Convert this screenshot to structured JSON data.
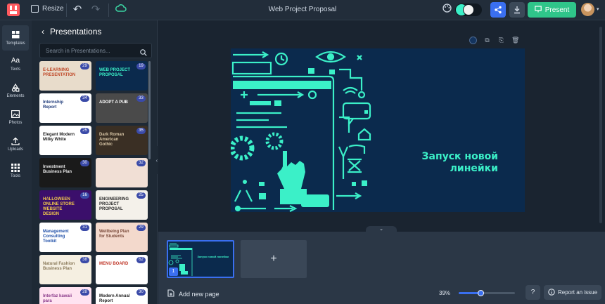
{
  "topbar": {
    "resize_label": "Resize",
    "document_title": "Web Project Proposal",
    "present_label": "Present"
  },
  "rail": {
    "items": [
      {
        "label": "Templates",
        "icon": "templates-icon"
      },
      {
        "label": "Texts",
        "icon": "text-icon"
      },
      {
        "label": "Elements",
        "icon": "elements-icon"
      },
      {
        "label": "Photos",
        "icon": "photo-icon"
      },
      {
        "label": "Uploads",
        "icon": "upload-icon"
      },
      {
        "label": "Tools",
        "icon": "tools-icon"
      }
    ]
  },
  "panel": {
    "title": "Presentations",
    "search_placeholder": "Search in Presentations...",
    "templates": [
      {
        "title": "E-LEARNING PRESENTATION",
        "count": "29",
        "bg": "#e8dccb",
        "fg": "#c04b2b"
      },
      {
        "title": "WEB PROJECT PROPOSAL",
        "count": "19",
        "bg": "#0b2a4d",
        "fg": "#3bf0c8"
      },
      {
        "title": "Internship Report",
        "count": "34",
        "bg": "#ffffff",
        "fg": "#1f3b7a"
      },
      {
        "title": "ADOPT A PUB",
        "count": "33",
        "bg": "#4a4a4a",
        "fg": "#ffffff"
      },
      {
        "title": "Elegant Modern Milky White",
        "count": "25",
        "bg": "#ffffff",
        "fg": "#222222"
      },
      {
        "title": "Dark Roman American Gothic",
        "count": "35",
        "bg": "#3a2f24",
        "fg": "#d9c7a7"
      },
      {
        "title": "Investment Business Plan",
        "count": "30",
        "bg": "#1a1a1a",
        "fg": "#e6e6e6"
      },
      {
        "title": "",
        "count": "32",
        "bg": "#f1dfd5",
        "fg": "#8a6a5a"
      },
      {
        "title": "HALLOWEEN ONLINE STORE WEBSITE DESIGN",
        "count": "16",
        "bg": "#3b0f6b",
        "fg": "#f2c94c"
      },
      {
        "title": "ENGINEERING PROJECT PROPOSAL",
        "count": "25",
        "bg": "#f4f1ea",
        "fg": "#2a2a2a"
      },
      {
        "title": "Management Consulting Toolkit",
        "count": "31",
        "bg": "#ffffff",
        "fg": "#1f4fa8"
      },
      {
        "title": "Wellbeing Plan for Students",
        "count": "29",
        "bg": "#f3d9cc",
        "fg": "#7a4a3a"
      },
      {
        "title": "Natural Fashion Business Plan",
        "count": "38",
        "bg": "#f5efe1",
        "fg": "#8a7a5a"
      },
      {
        "title": "MENU BOARD",
        "count": "62",
        "bg": "#ffffff",
        "fg": "#c0392b"
      },
      {
        "title": "Interfaz kawaii para",
        "count": "28",
        "bg": "#ffe3f1",
        "fg": "#8a3a8a"
      },
      {
        "title": "Modern Annual Report",
        "count": "30",
        "bg": "#ffffff",
        "fg": "#222222"
      }
    ]
  },
  "slide": {
    "heading": "Запуск новой линейки",
    "accent": "#3bf0c8",
    "background": "#0b2a4d"
  },
  "pages": {
    "current_number": "1",
    "add_page_label": "Add new page",
    "zoom": "39%",
    "zoom_fraction": 0.39
  },
  "footer": {
    "report_label": "Report an issue"
  }
}
